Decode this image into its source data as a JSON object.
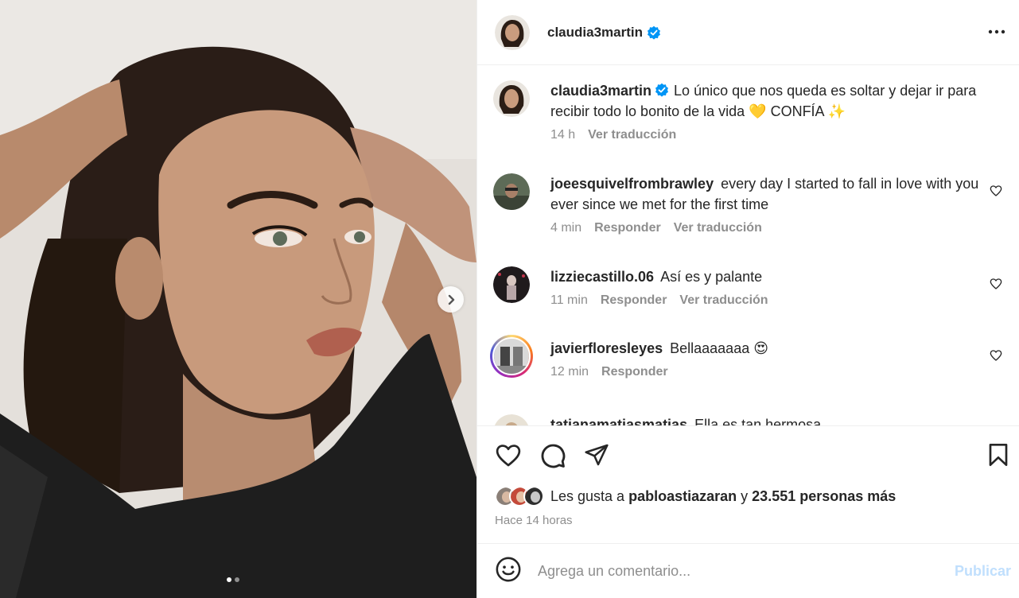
{
  "post": {
    "author": "claudia3martin",
    "verified": true,
    "image_alt_dots": 2,
    "active_dot": 0
  },
  "header": {
    "username": "claudia3martin",
    "more_icon": "more-horizontal-icon"
  },
  "caption": {
    "username": "claudia3martin",
    "text": "Lo único que nos queda es soltar y dejar ir para recibir todo lo bonito de la vida 💛 CONFÍA ✨",
    "time": "14 h",
    "translate": "Ver traducción"
  },
  "comments": [
    {
      "username": "joeesquivelfrombrawley",
      "text": "every day I started to fall in love with you ever since we met for the first time",
      "time": "4 min",
      "reply": "Responder",
      "translate": "Ver traducción"
    },
    {
      "username": "lizziecastillo.06",
      "text": "Así es y palante",
      "time": "11 min",
      "reply": "Responder",
      "translate": "Ver traducción"
    },
    {
      "username": "javierfloresleyes",
      "text": "Bellaaaaaaa 😍",
      "time": "12 min",
      "reply": "Responder"
    },
    {
      "username": "tatianamatiasmatias",
      "text": "Ella es tan hermosa"
    }
  ],
  "likes": {
    "prefix": "Les gusta a",
    "user": "pabloastiazaran",
    "connector": "y",
    "others": "23.551 personas más"
  },
  "time_ago": "Hace 14 horas",
  "add_comment": {
    "placeholder": "Agrega un comentario...",
    "publish": "Publicar"
  },
  "colors": {
    "verified": "#0095f6",
    "muted": "#8e8e8e",
    "publish_disabled": "#c0dffd"
  }
}
